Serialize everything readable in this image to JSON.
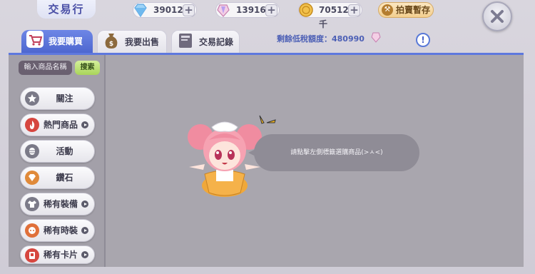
{
  "header": {
    "title": "交易行",
    "diamonds": "39012",
    "crystals": "13916",
    "coins": "705126千",
    "auction_label": "拍賣暫存"
  },
  "tabs": [
    {
      "label": "我要購買",
      "active": true
    },
    {
      "label": "我要出售",
      "active": false
    },
    {
      "label": "交易記錄",
      "active": false
    }
  ],
  "quota": {
    "label": "剩餘低稅額度：480990"
  },
  "search": {
    "input_label": "輸入商品名稱",
    "button_label": "搜索"
  },
  "categories": [
    {
      "label": "關注",
      "icon": "star-icon",
      "has_arrow": false
    },
    {
      "label": "熱門商品",
      "icon": "hot-icon",
      "has_arrow": true
    },
    {
      "label": "活動",
      "icon": "lantern-icon",
      "has_arrow": false
    },
    {
      "label": "鑽石",
      "icon": "diamond-icon",
      "has_arrow": false
    },
    {
      "label": "稀有裝備",
      "icon": "shirt-icon",
      "has_arrow": true
    },
    {
      "label": "稀有時裝",
      "icon": "fashion-icon",
      "has_arrow": true
    },
    {
      "label": "稀有卡片",
      "icon": "card-icon",
      "has_arrow": true
    }
  ],
  "message": "請點擊左側標籤選購商品(>ㅅ<)",
  "colors": {
    "accent": "#4e67cf",
    "panel": "#a9a6ae",
    "bubble": "#8f8c96"
  }
}
